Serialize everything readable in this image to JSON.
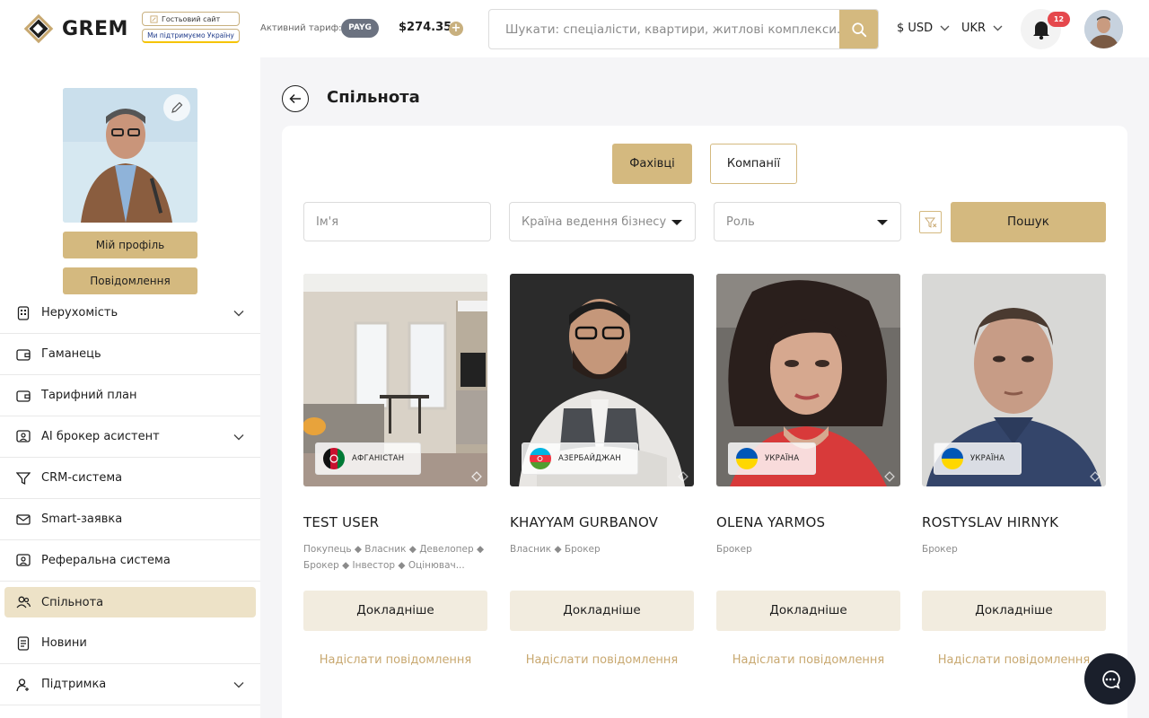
{
  "header": {
    "brand": "GREM",
    "guest_site_label": "Гостьовий сайт",
    "ukraine_support_label": "Ми підтримуємо Україну",
    "tariff_label": "Активний тариф:",
    "tariff_badge": "PAYG",
    "balance": "$274.35",
    "search_placeholder": "Шукати: спеціалісти, квартири, житлові комплекси...",
    "currency": "$ USD",
    "language": "UKR",
    "notifications_count": "12"
  },
  "sidebar": {
    "my_profile_label": "Мій профіль",
    "messages_label": "Повідомлення",
    "items": [
      {
        "label": "Нерухомість",
        "icon": "building-icon",
        "has_chevron": true
      },
      {
        "label": "Гаманець",
        "icon": "wallet-icon",
        "has_chevron": false
      },
      {
        "label": "Тарифний план",
        "icon": "wallet-icon",
        "has_chevron": false
      },
      {
        "label": "AI брокер асистент",
        "icon": "ai-broker-icon",
        "has_chevron": true
      },
      {
        "label": "CRM-система",
        "icon": "funnel-icon",
        "has_chevron": false
      },
      {
        "label": "Smart-заявка",
        "icon": "mail-icon",
        "has_chevron": false
      },
      {
        "label": "Реферальна система",
        "icon": "referral-icon",
        "has_chevron": false
      },
      {
        "label": "Спільнота",
        "icon": "users-icon",
        "has_chevron": false,
        "active": true
      },
      {
        "label": "Новини",
        "icon": "news-icon",
        "has_chevron": false
      },
      {
        "label": "Підтримка",
        "icon": "support-icon",
        "has_chevron": true
      }
    ]
  },
  "page": {
    "title": "Спільнота",
    "tabs": [
      "Фахівці",
      "Компанії"
    ],
    "active_tab": "Фахівці",
    "filters": {
      "name_placeholder": "Ім'я",
      "country_placeholder": "Країна ведення бізнесу",
      "role_placeholder": "Роль",
      "search_label": "Пошук"
    },
    "cards": [
      {
        "name": "TEST USER",
        "country": "АФГАНІСТАН",
        "roles": "Покупець ◆ Власник ◆ Девелопер ◆ Брокер ◆ Інвестор ◆ Оцінювач...",
        "more_label": "Докладніше",
        "message_label": "Надіслати повідомлення"
      },
      {
        "name": "KHAYYAM GURBANOV",
        "country": "АЗЕРБАЙДЖАН",
        "roles": "Власник ◆ Брокер",
        "more_label": "Докладніше",
        "message_label": "Надіслати повідомлення"
      },
      {
        "name": "OLENA YARMOS",
        "country": "УКРАЇНА",
        "roles": "Брокер",
        "more_label": "Докладніше",
        "message_label": "Надіслати повідомлення"
      },
      {
        "name": "ROSTYSLAV HIRNYK",
        "country": "УКРАЇНА",
        "roles": "Брокер",
        "more_label": "Докладніше",
        "message_label": "Надіслати повідомлення"
      }
    ]
  },
  "colors": {
    "accent_gold": "#d4b97f",
    "accent_light": "#f2ecdf",
    "active_nav": "#ede2c7",
    "badge_red": "#e5484d",
    "fab_dark": "#1a1f2b"
  }
}
